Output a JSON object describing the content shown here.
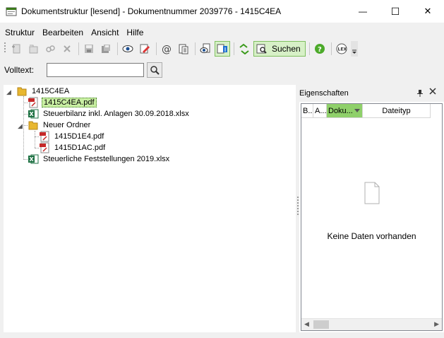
{
  "window": {
    "title": "Dokumentstruktur [lesend] - Dokumentnummer 2039776 - 1415C4EA",
    "controls": {
      "minimize": "—",
      "maximize": "☐",
      "close": "✕"
    }
  },
  "menu": [
    "Struktur",
    "Bearbeiten",
    "Ansicht",
    "Hilfe"
  ],
  "toolbar": {
    "search_label": "Suchen"
  },
  "volltext": {
    "label": "Volltext:",
    "value": ""
  },
  "tree": {
    "root": "1415C4EA",
    "items": [
      {
        "label": "1415C4EA.pdf",
        "type": "pdf",
        "selected": true
      },
      {
        "label": "Steuerbilanz inkl. Anlagen 30.09.2018.xlsx",
        "type": "xlsx"
      },
      {
        "label": "Neuer Ordner",
        "type": "folder"
      },
      {
        "label": "1415D1E4.pdf",
        "type": "pdf"
      },
      {
        "label": "1415D1AC.pdf",
        "type": "pdf"
      },
      {
        "label": "Steuerliche Feststellungen 2019.xlsx",
        "type": "xlsx"
      }
    ]
  },
  "properties": {
    "title": "Eigenschaften",
    "columns": [
      "B...",
      "A...",
      "Doku...",
      "Dateityp"
    ],
    "empty_text": "Keine Daten vorhanden"
  },
  "colors": {
    "accent_green": "#8fd06a",
    "selection": "#c9efa3",
    "excel_green": "#1f7244",
    "pdf_red": "#c62828",
    "folder_yellow": "#e8b730"
  }
}
